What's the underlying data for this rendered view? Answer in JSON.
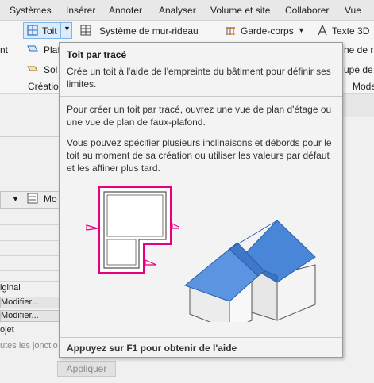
{
  "menubar": {
    "items": [
      "Systèmes",
      "Insérer",
      "Annoter",
      "Analyser",
      "Volume et site",
      "Collaborer",
      "Vue"
    ]
  },
  "ribbon": {
    "toit_label": "Toit",
    "mur_rideau_label": "Système de mur-rideau",
    "garde_corps_label": "Garde-corps",
    "texte3d_label": "Texte 3D",
    "left_partial_1": "nt",
    "plaf_partial": "Plaf",
    "sol_label": "Sol",
    "creation_partial": "Création",
    "right_partial_1": "ne de r",
    "right_partial_2": "upe de",
    "right_partial_3": "Mode"
  },
  "tooltip": {
    "title": "Toit par tracé",
    "para1": "Crée un toit à l'aide de l'empreinte du bâtiment pour définir ses limites.",
    "para2": "Pour créer un toit par tracé, ouvrez une vue de plan d'étage ou une vue de plan de faux-plafond.",
    "para3": "Vous pouvez spécifier plusieurs inclinaisons et débords pour le toit au moment de sa création ou utiliser les valeurs par défaut et les affiner plus tard.",
    "footer": "Appuyez sur F1 pour obtenir de l'aide",
    "colors": {
      "outline": "#e6007e",
      "roof": "#4a86d8",
      "wall": "#f2f2f2"
    }
  },
  "left_panel": {
    "mo_label": "Mo",
    "rows": [
      "iginal",
      "Modifier...",
      "Modifier...",
      "ojet",
      "utes les jonctio"
    ]
  },
  "apply_button": "Appliquer"
}
